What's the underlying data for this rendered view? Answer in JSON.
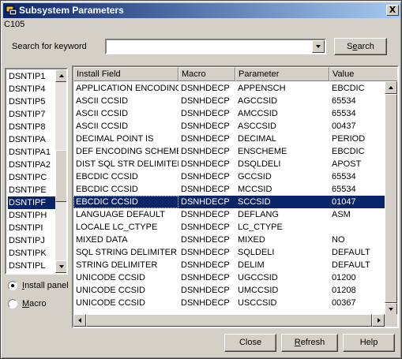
{
  "window": {
    "title": "Subsystem Parameters",
    "subtitle": "C105",
    "close_glyph": "X"
  },
  "search": {
    "label": "Search for keyword",
    "value": "",
    "button_label": "Search"
  },
  "left_list": {
    "items": [
      "DSNTIP1",
      "DSNTIP4",
      "DSNTIP5",
      "DSNTIP7",
      "DSNTIP8",
      "DSNTIPA",
      "DSNTIPA1",
      "DSNTIPA2",
      "DSNTIPC",
      "DSNTIPE",
      "DSNTIPF",
      "DSNTIPH",
      "DSNTIPI",
      "DSNTIPJ",
      "DSNTIPK",
      "DSNTIPL"
    ],
    "selected": "DSNTIPF"
  },
  "view_mode": {
    "install_panel": "Install panel",
    "macro": "Macro",
    "selected": "Install panel"
  },
  "table": {
    "columns": [
      "Install Field",
      "Macro",
      "Parameter",
      "Value"
    ],
    "rows": [
      [
        "APPLICATION ENCODING",
        "DSNHDECP",
        "APPENSCH",
        "EBCDIC"
      ],
      [
        "ASCII CCSID",
        "DSNHDECP",
        "AGCCSID",
        "65534"
      ],
      [
        "ASCII CCSID",
        "DSNHDECP",
        "AMCCSID",
        "65534"
      ],
      [
        "ASCII CCSID",
        "DSNHDECP",
        "ASCCSID",
        "00437"
      ],
      [
        "DECIMAL POINT IS",
        "DSNHDECP",
        "DECIMAL",
        "PERIOD"
      ],
      [
        "DEF ENCODING SCHEME",
        "DSNHDECP",
        "ENSCHEME",
        "EBCDIC"
      ],
      [
        "DIST SQL STR DELIMITER",
        "DSNHDECP",
        "DSQLDELI",
        "APOST"
      ],
      [
        "EBCDIC CCSID",
        "DSNHDECP",
        "GCCSID",
        "65534"
      ],
      [
        "EBCDIC CCSID",
        "DSNHDECP",
        "MCCSID",
        "65534"
      ],
      [
        "EBCDIC CCSID",
        "DSNHDECP",
        "SCCSID",
        "01047"
      ],
      [
        "LANGUAGE DEFAULT",
        "DSNHDECP",
        "DEFLANG",
        "ASM"
      ],
      [
        "LOCALE LC_CTYPE",
        "DSNHDECP",
        "LC_CTYPE",
        ""
      ],
      [
        "MIXED DATA",
        "DSNHDECP",
        "MIXED",
        "NO"
      ],
      [
        "SQL STRING DELIMITER",
        "DSNHDECP",
        "SQLDELI",
        "DEFAULT"
      ],
      [
        "STRING DELIMITER",
        "DSNHDECP",
        "DELIM",
        "DEFAULT"
      ],
      [
        "UNICODE CCSID",
        "DSNHDECP",
        "UGCCSID",
        "01200"
      ],
      [
        "UNICODE CCSID",
        "DSNHDECP",
        "UMCCSID",
        "01208"
      ],
      [
        "UNICODE CCSID",
        "DSNHDECP",
        "USCCSID",
        "00367"
      ]
    ],
    "selected_row": 9
  },
  "buttons": {
    "close": "Close",
    "refresh": "Refresh",
    "help": "Help"
  },
  "colors": {
    "title_start": "#0a246a",
    "title_end": "#a6caf0",
    "selection": "#0a246a",
    "face": "#d4d0c8"
  }
}
